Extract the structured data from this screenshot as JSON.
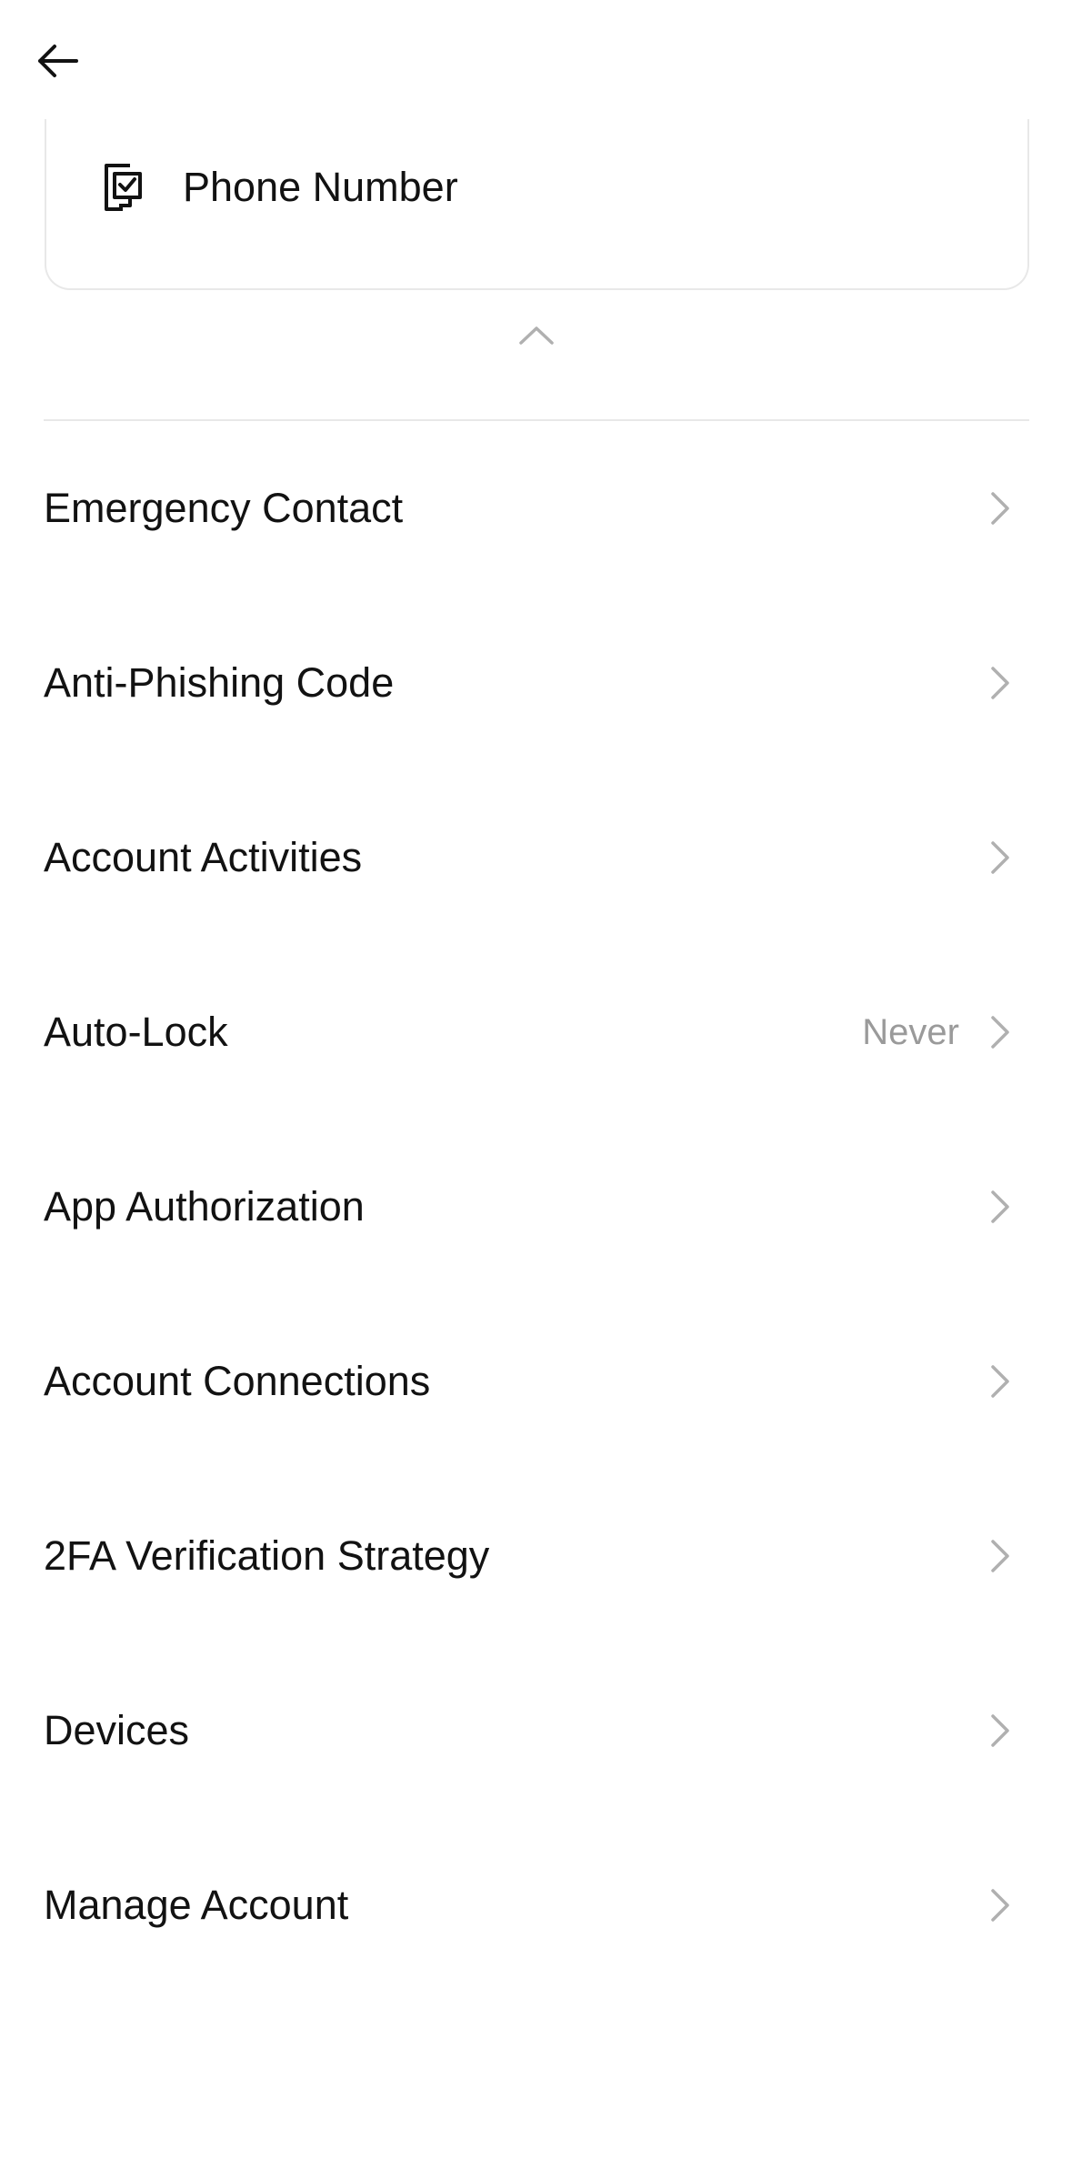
{
  "header": {
    "back_icon": "arrow-left-icon"
  },
  "phone_card": {
    "icon": "phone-check-icon",
    "label": "Phone Number"
  },
  "collapse_icon": "chevron-up-icon",
  "menu": {
    "items": [
      {
        "label": "Emergency Contact",
        "value": ""
      },
      {
        "label": "Anti-Phishing Code",
        "value": ""
      },
      {
        "label": "Account Activities",
        "value": ""
      },
      {
        "label": "Auto-Lock",
        "value": "Never"
      },
      {
        "label": "App Authorization",
        "value": ""
      },
      {
        "label": "Account Connections",
        "value": ""
      },
      {
        "label": "2FA Verification Strategy",
        "value": ""
      },
      {
        "label": "Devices",
        "value": ""
      },
      {
        "label": "Manage Account",
        "value": ""
      }
    ],
    "chevron_icon": "chevron-right-icon"
  },
  "colors": {
    "text_primary": "#121212",
    "text_secondary": "#9a9a9a",
    "divider": "#e8e8e8",
    "chevron": "#b0b0b0"
  }
}
